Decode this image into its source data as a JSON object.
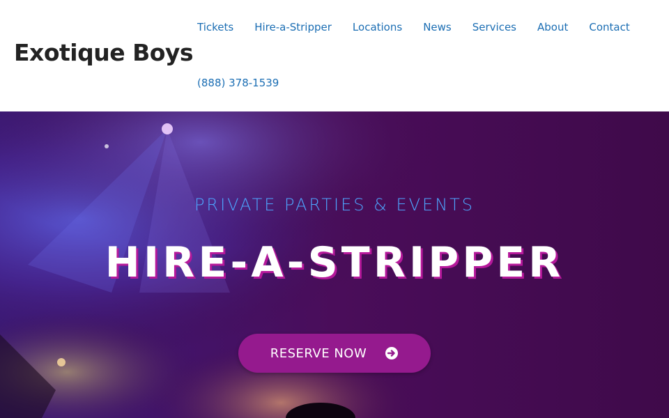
{
  "header": {
    "brand": "Exotique Boys",
    "nav": {
      "items": [
        {
          "label": "Tickets"
        },
        {
          "label": "Hire-a-Stripper"
        },
        {
          "label": "Locations"
        },
        {
          "label": "News"
        },
        {
          "label": "Services"
        },
        {
          "label": "About"
        },
        {
          "label": "Contact"
        }
      ]
    },
    "phone": "(888) 378-1539"
  },
  "hero": {
    "eyebrow": "PRIVATE PARTIES & EVENTS",
    "title": "HIRE-A-STRIPPER",
    "cta": {
      "label": "RESERVE NOW",
      "icon": "circle-arrow-right-icon"
    }
  },
  "colors": {
    "link": "#1a6db3",
    "brand_text": "#222222",
    "hero_bg": "#3d0a45",
    "eyebrow": "#4ea6ff",
    "title_shadow": "#b5189a",
    "button": "#951a8e"
  }
}
